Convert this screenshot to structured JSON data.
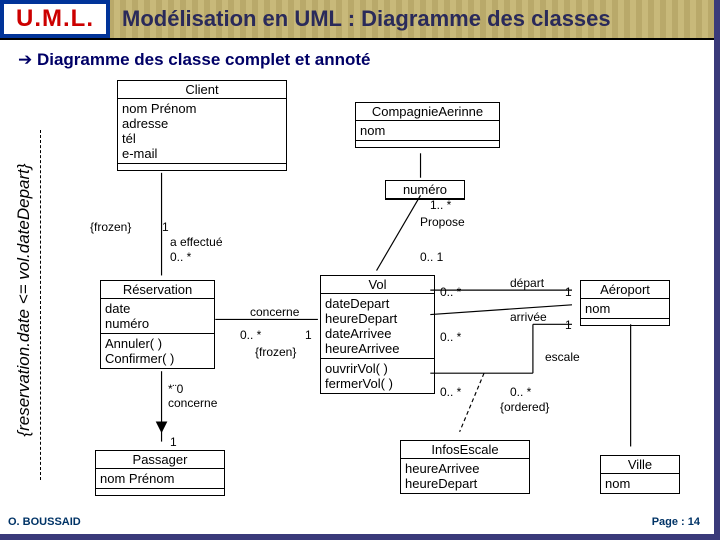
{
  "header": {
    "logo": "U.M.L.",
    "title": "Modélisation en UML : Diagramme des classes"
  },
  "subhead": "Diagramme des classe complet et annoté",
  "side_constraint": "{reservation.date <= vol.dateDepart}",
  "classes": {
    "client": {
      "name": "Client",
      "attrs": [
        "nom Prénom",
        "adresse",
        "tél",
        "e-mail"
      ]
    },
    "reservation": {
      "name": "Réservation",
      "attrs": [
        "date",
        "numéro"
      ],
      "ops": [
        "Annuler( )",
        "Confirmer( )"
      ]
    },
    "passager": {
      "name": "Passager",
      "attrs": [
        "nom Prénom"
      ]
    },
    "compagnie": {
      "name": "CompagnieAerinne",
      "attrs": [
        "nom"
      ]
    },
    "vol": {
      "name": "Vol",
      "attrs": [
        "dateDepart",
        "heureDepart",
        "dateArrivee",
        "heureArrivee"
      ],
      "ops": [
        "ouvrirVol( )",
        "fermerVol( )"
      ]
    },
    "infos": {
      "name": "InfosEscale",
      "attrs": [
        "heureArrivee",
        "heureDepart"
      ]
    },
    "aeroport": {
      "name": "Aéroport",
      "attrs": [
        "nom"
      ]
    },
    "ville": {
      "name": "Ville",
      "attrs": [
        "nom"
      ]
    },
    "numero": {
      "name": "numéro"
    }
  },
  "labels": {
    "frozen1": "{frozen}",
    "frozen2": "{frozen}",
    "one_a": "1",
    "a_effectue": "a effectué",
    "zero_star_a": "0.. *",
    "concerne1": "concerne",
    "zero_star_b": "0.. *",
    "one_b": "1",
    "star_zero": "*¨0",
    "concerne2": "concerne",
    "one_c": "1",
    "one_star": "1.. *",
    "propose": "Propose",
    "zero_one": "0.. 1",
    "depart": "départ",
    "arrivee": "arrivée",
    "escale": "escale",
    "zero_star_c": "0.. *",
    "zero_star_d": "0.. *",
    "zero_star_e": "0.. *",
    "zero_star_f": "0.. *",
    "one_d": "1",
    "one_e": "1",
    "ordered": "{ordered}"
  },
  "footer": {
    "left": "O. BOUSSAID",
    "right": "Page : 14"
  }
}
